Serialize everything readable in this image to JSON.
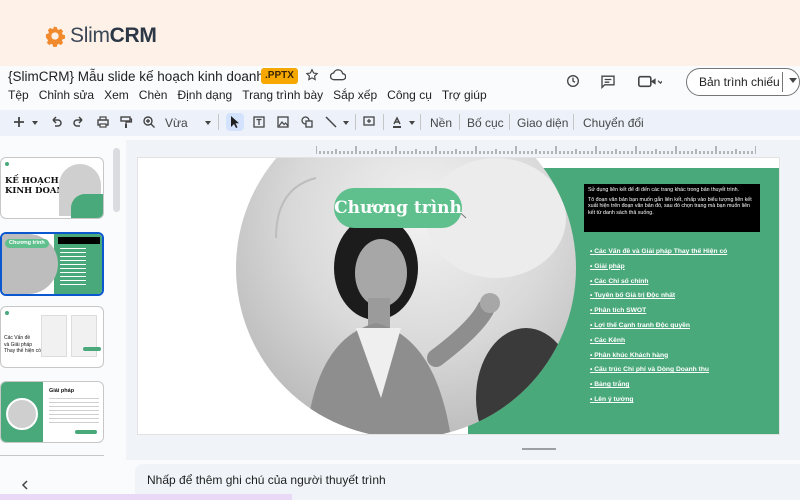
{
  "brand": {
    "name_light": "Slim",
    "name_bold": "CRM",
    "accent": "#f08a2c"
  },
  "document": {
    "title": "{SlimCRM} Mẫu slide kế hoạch kinh doanh",
    "badge": ".PPTX"
  },
  "menu": [
    "Tệp",
    "Chỉnh sửa",
    "Xem",
    "Chèn",
    "Định dạng",
    "Trang trình bày",
    "Sắp xếp",
    "Công cụ",
    "Trợ giúp"
  ],
  "header_actions": {
    "present_label": "Bản trình chiếu"
  },
  "toolbar": {
    "zoom_value": "Vừa",
    "background_label": "Nền",
    "layout_label": "Bố cục",
    "theme_label": "Giao diện",
    "transition_label": "Chuyển đổi"
  },
  "thumbnails": [
    {
      "lines": [
        "KẾ HOẠCH",
        "KINH DOANH"
      ]
    },
    {
      "title": "Chương trình",
      "selected": true
    },
    {
      "lines": [
        "Các Vấn đề",
        "và Giải pháp",
        "Thay thế hiện có"
      ]
    },
    {
      "title": "Giải pháp"
    }
  ],
  "slide": {
    "title": "Chương trình",
    "note_paragraphs": [
      "Sử dụng liên kết để đi đến các trang khác trong bản thuyết trình.",
      "Tô đoạn văn bản bạn muốn gắn liên kết, nhấp vào biểu tượng liên kết xuất hiện trên đoạn văn bản đó, sau đó chọn trang mà bạn muốn liên kết từ danh sách thả xuống."
    ],
    "agenda": [
      "Các Vấn đề và Giải pháp Thay thế Hiện có",
      "Giải pháp",
      "Các Chỉ số chính",
      "Tuyên bố Giá trị Độc nhất",
      "Phân tích SWOT",
      "Lợi thế Cạnh tranh Độc quyền",
      "Các Kênh",
      "Phân khúc Khách hàng",
      "Cấu trúc Chi phí và Dòng Doanh thu",
      "Bảng trắng",
      "Lên ý tưởng"
    ],
    "colors": {
      "green": "#4aa97b",
      "pill": "#5fc08d"
    }
  },
  "notes": {
    "placeholder": "Nhấp để thêm ghi chú của người thuyết trình"
  }
}
